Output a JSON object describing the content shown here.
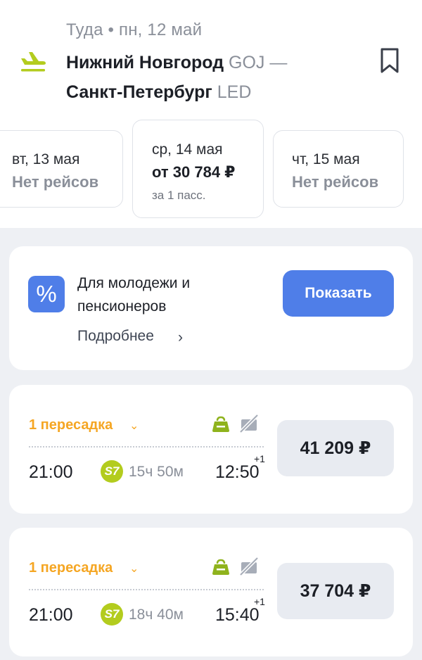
{
  "header": {
    "direction": "Туда • пн, 12 май",
    "from_city": "Нижний Новгород",
    "from_code": "GOJ",
    "separator": " —",
    "to_city": "Санкт-Петербург",
    "to_code": "LED",
    "icons": {
      "plane": "plane-departure-icon",
      "bookmark": "bookmark-icon"
    },
    "accent_color": "#b3cc1e"
  },
  "dates": [
    {
      "date": "вт, 13 мая",
      "status": "Нет рейсов"
    },
    {
      "date": "ср, 14 мая",
      "price": "от 30 784 ₽",
      "note": "за 1 пасс.",
      "selected": true
    },
    {
      "date": "чт, 15 мая",
      "status": "Нет рейсов"
    }
  ],
  "promo": {
    "icon_symbol": "%",
    "title_line1": "Для молодежи и",
    "title_line2": "пенсионеров",
    "link": "Подробнее",
    "link_chevron": "›",
    "button": "Показать",
    "color": "#4f7ee8"
  },
  "flights": [
    {
      "transfers": "1 пересадка",
      "depart": "21:00",
      "airline_logo": "S7",
      "duration": "15ч 50м",
      "arrive": "12:50",
      "day_offset": "+1",
      "price": "41 209 ₽"
    },
    {
      "transfers": "1 пересадка",
      "depart": "21:00",
      "airline_logo": "S7",
      "duration": "18ч 40м",
      "arrive": "15:40",
      "day_offset": "+1",
      "price": "37 704 ₽"
    }
  ]
}
